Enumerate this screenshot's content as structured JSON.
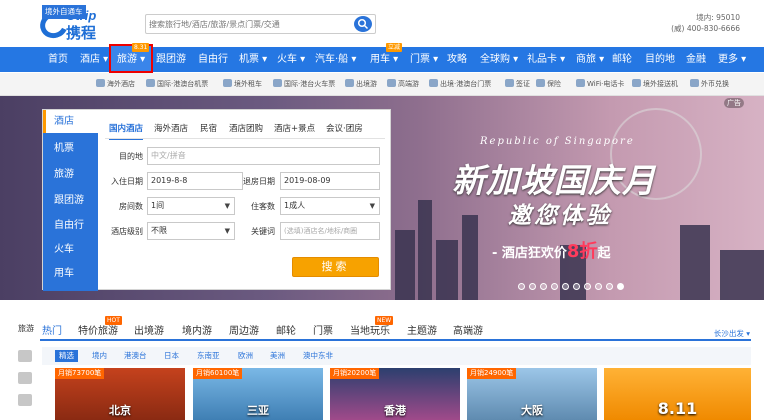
{
  "header": {
    "logo_en": "Ctrip",
    "logo_cn": "携程",
    "search_placeholder": "搜索旅行地/酒店/旅游/景点门票/交通",
    "hotline_domestic": "境内: 95010",
    "hotline_intl": "(威)  400-830-6666"
  },
  "nav": {
    "items": [
      "首页",
      "酒店",
      "旅游",
      "跟团游",
      "自由行",
      "机票",
      "火车",
      "汽车·船",
      "用车",
      "门票",
      "攻略",
      "全球购",
      "礼品卡",
      "商旅",
      "邮轮",
      "目的地",
      "金融",
      "更多"
    ],
    "badge_travel": "8.31",
    "badge_car": "立减"
  },
  "subnav": {
    "tag": "境外自通车",
    "items": [
      "海外酒店",
      "国际·港澳台机票",
      "境外租车",
      "国际·港台火车票",
      "出境游",
      "高端游",
      "出境·港澳台门票",
      "签证",
      "保险",
      "WiFi·电话卡",
      "境外接送机",
      "外币兑换"
    ]
  },
  "banner": {
    "ad_label": "广告",
    "republic": "Republic of Singapore",
    "title": "新加坡国庆月",
    "subtitle": "邀您体验",
    "promo_prefix": "- 酒店狂欢价",
    "promo_discount": "8折",
    "promo_suffix": "起"
  },
  "booking": {
    "side_items": [
      "酒店",
      "机票",
      "旅游",
      "跟团游",
      "自由行",
      "火车",
      "用车"
    ],
    "tabs": [
      "国内酒店",
      "海外酒店",
      "民宿",
      "酒店团购",
      "酒店+景点",
      "会议·团房"
    ],
    "dest_label": "目的地",
    "dest_placeholder": "中文/拼音",
    "checkin_label": "入住日期",
    "checkin_value": "2019-8-8",
    "checkout_label": "退房日期",
    "checkout_value": "2019-08-09",
    "rooms_label": "房间数",
    "rooms_value": "1间",
    "guests_label": "住客数",
    "guests_value": "1成人",
    "level_label": "酒店级别",
    "level_value": "不限",
    "keyword_label": "关键词",
    "keyword_placeholder": "(选填)酒店名/地标/商圈",
    "submit": "搜索"
  },
  "bottom": {
    "side_label": "旅游",
    "tabs": [
      "热门",
      "特价旅游",
      "出境游",
      "境内游",
      "周边游",
      "邮轮",
      "门票",
      "当地玩乐",
      "主题游",
      "高端游"
    ],
    "hot_badge": "HOT",
    "new_badge": "NEW",
    "city_select": "长沙出发 ▾",
    "chips": [
      "精选",
      "境内",
      "港澳台",
      "日本",
      "东南亚",
      "欧洲",
      "美洲",
      "澳中东非"
    ],
    "cards": [
      {
        "sold": "月销73700笔",
        "city": "北京"
      },
      {
        "sold": "月销60100笔",
        "city": "三亚"
      },
      {
        "sold": "月销20200笔",
        "city": "香港"
      },
      {
        "sold": "月销24900笔",
        "city": "大阪"
      },
      {
        "sold": "",
        "city": "8.11"
      }
    ]
  }
}
